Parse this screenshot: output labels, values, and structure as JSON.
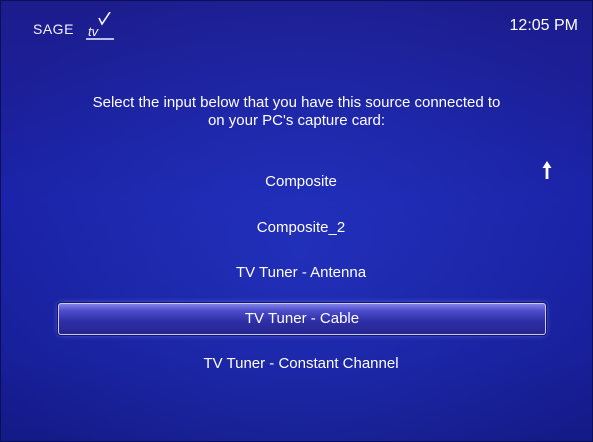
{
  "header": {
    "logo_text": "SAGE tv",
    "clock": "12:05 PM"
  },
  "prompt": {
    "line1": "Select the input below that you have this source connected to",
    "line2": "on your PC's capture card:"
  },
  "options": [
    {
      "label": "Composite",
      "selected": false
    },
    {
      "label": "Composite_2",
      "selected": false
    },
    {
      "label": "TV Tuner - Antenna",
      "selected": false
    },
    {
      "label": "TV Tuner - Cable",
      "selected": true
    },
    {
      "label": "TV Tuner - Constant Channel",
      "selected": false
    }
  ],
  "icons": {
    "scroll_up": "up-arrow-icon",
    "logo_mark": "checkmark-icon"
  },
  "colors": {
    "background": "#1a22a6",
    "text": "#ffffff",
    "highlight": "#3030a8",
    "highlight_border": "#c8c8ff"
  }
}
